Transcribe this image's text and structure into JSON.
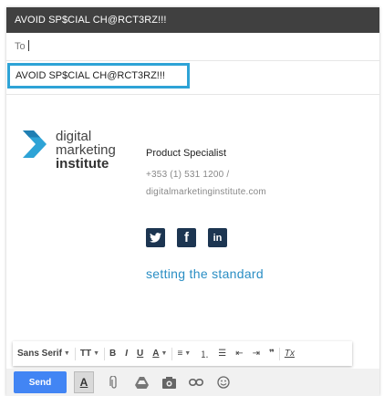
{
  "compose": {
    "title": "AVOID SP$CIAL CH@RCT3RZ!!!",
    "to_label": "To",
    "subject": "AVOID SP$CIAL CH@RCT3RZ!!!"
  },
  "signature": {
    "logo": {
      "line1": "digital",
      "line2": "marketing",
      "line3": "institute"
    },
    "role": "Product Specialist",
    "phone": "+353 (1) 531 1200  /",
    "website": "digitalmarketinginstitute.com",
    "socials": [
      {
        "name": "twitter",
        "glyph": "t"
      },
      {
        "name": "facebook",
        "glyph": "f"
      },
      {
        "name": "linkedin",
        "glyph": "in"
      }
    ],
    "tagline": "setting the standard"
  },
  "toolbar": {
    "font_family": "Sans Serif",
    "size_glyph": "TT",
    "bold": "B",
    "italic": "I",
    "underline": "U",
    "text_color": "A",
    "align_glyph": "≡",
    "numbered_glyph": "⒈",
    "bulleted_glyph": "☰",
    "indent_less_glyph": "⇤",
    "indent_more_glyph": "⇥",
    "quote_glyph": "❞",
    "clear_glyph": "Tx"
  },
  "bottom": {
    "send_label": "Send",
    "format_glyph": "A",
    "icons": [
      "paperclip-icon",
      "drive-icon",
      "camera-icon",
      "link-icon",
      "emoji-icon"
    ]
  }
}
